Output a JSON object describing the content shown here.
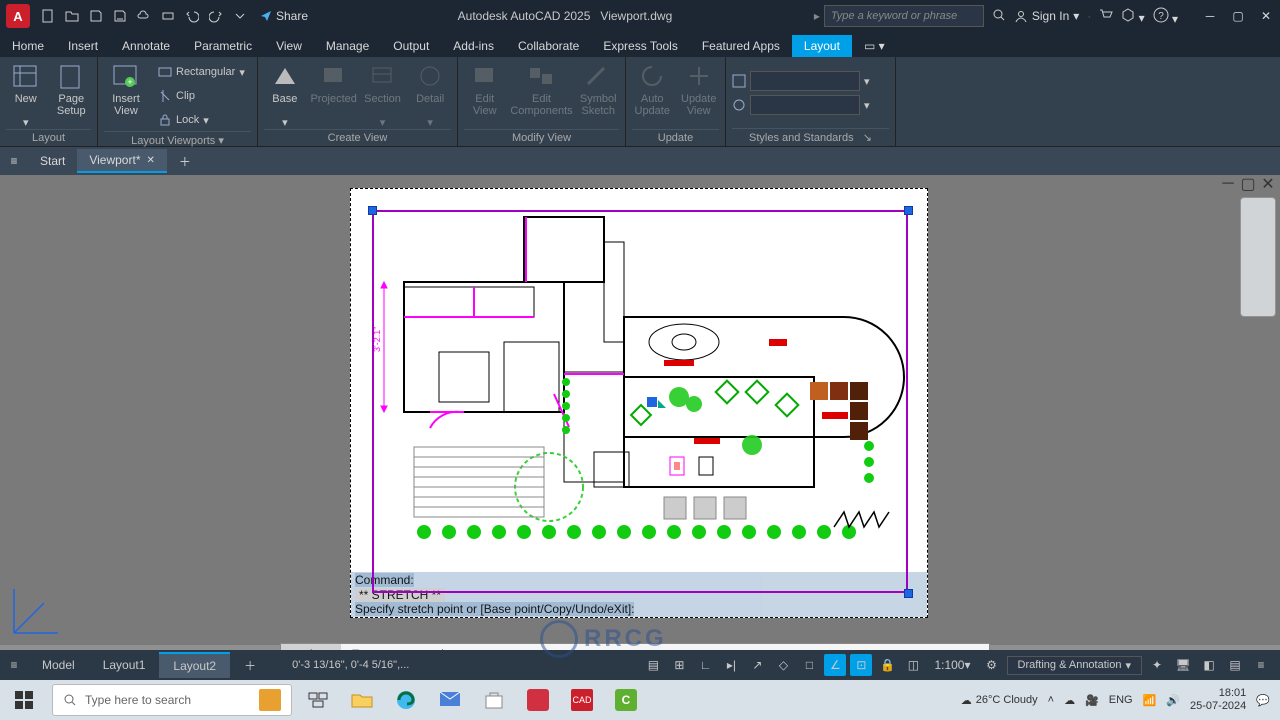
{
  "app": {
    "icon_letter": "A",
    "title_mid": "Autodesk AutoCAD 2025",
    "title_file": "Viewport.dwg",
    "search_placeholder": "Type a keyword or phrase",
    "sign_in": "Sign In",
    "share": "Share"
  },
  "menus": [
    "Home",
    "Insert",
    "Annotate",
    "Parametric",
    "View",
    "Manage",
    "Output",
    "Add-ins",
    "Collaborate",
    "Express Tools",
    "Featured Apps",
    "Layout"
  ],
  "active_menu": "Layout",
  "ribbon": {
    "panels": [
      {
        "title": "Layout",
        "buttons": [
          {
            "label": "New"
          },
          {
            "label": "Page\nSetup"
          }
        ]
      },
      {
        "title": "Layout Viewports",
        "buttons": [
          {
            "label": "Insert View"
          }
        ],
        "stack": [
          {
            "label": "Rectangular"
          },
          {
            "label": "Clip"
          },
          {
            "label": "Lock"
          }
        ]
      },
      {
        "title": "Create View",
        "buttons": [
          {
            "label": "Base"
          },
          {
            "label": "Projected",
            "disabled": true
          },
          {
            "label": "Section",
            "disabled": true
          },
          {
            "label": "Detail",
            "disabled": true
          }
        ]
      },
      {
        "title": "Modify View",
        "buttons": [
          {
            "label": "Edit\nView",
            "disabled": true
          },
          {
            "label": "Edit\nComponents",
            "disabled": true
          },
          {
            "label": "Symbol\nSketch",
            "disabled": true
          }
        ]
      },
      {
        "title": "Update",
        "buttons": [
          {
            "label": "Auto\nUpdate",
            "disabled": true
          },
          {
            "label": "Update\nView",
            "disabled": true
          }
        ]
      },
      {
        "title": "Styles and Standards",
        "dropdowns": 2
      }
    ]
  },
  "doc_tabs": {
    "start": "Start",
    "active": "Viewport*"
  },
  "cmd": {
    "line1": "Command:",
    "line2": "** STRETCH **",
    "line3": "Specify stretch point or [Base point/Copy/Undo/eXit]:",
    "input_placeholder": "Type a command"
  },
  "dim_label": "3'-2.1\"",
  "layout_tabs": [
    "Model",
    "Layout1",
    "Layout2"
  ],
  "active_layout": "Layout2",
  "status": {
    "coords": "0'-3 13/16\", 0'-4 5/16\",...",
    "scale": "1:100",
    "workspace": "Drafting & Annotation"
  },
  "taskbar": {
    "search_placeholder": "Type here to search",
    "weather": "26°C  Cloudy",
    "lang": "ENG",
    "time": "18:01",
    "date": "25-07-2024"
  },
  "watermark_text": "RRCG"
}
